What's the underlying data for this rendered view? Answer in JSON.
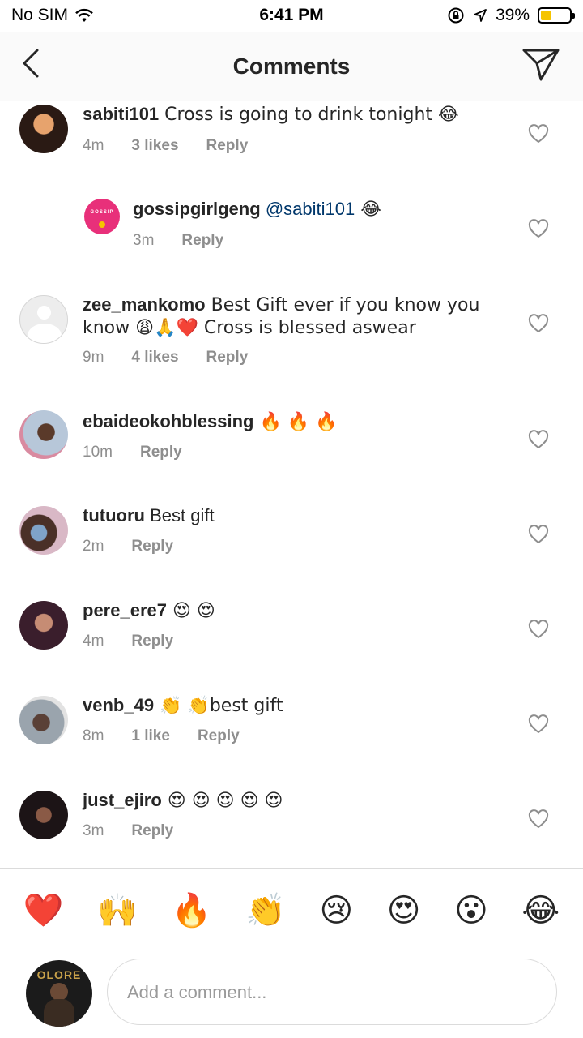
{
  "status": {
    "carrier": "No SIM",
    "time": "6:41 PM",
    "battery": "39%",
    "battery_level": 0.39
  },
  "nav": {
    "title": "Comments"
  },
  "comments": [
    {
      "username": "sabiti101",
      "text": " Cross is going to drink tonight 😂",
      "time": "4m",
      "likes": "3 likes",
      "reply": "Reply"
    },
    {
      "username": "gossipgirlgeng",
      "mention": "@sabiti101",
      "text": " 😂",
      "time": "3m",
      "reply": "Reply"
    },
    {
      "username": "zee_mankomo",
      "text": " Best Gift ever if you know you know 😩🙏❤️ Cross is blessed aswear",
      "time": "9m",
      "likes": "4 likes",
      "reply": "Reply"
    },
    {
      "username": "ebaideokohblessing",
      "text": " 🔥 🔥 🔥",
      "time": "10m",
      "reply": "Reply"
    },
    {
      "username": "tutuoru",
      "text": " Best gift",
      "time": "2m",
      "reply": "Reply"
    },
    {
      "username": "pere_ere7",
      "text": " 😍 😍",
      "time": "4m",
      "reply": "Reply"
    },
    {
      "username": "venb_49",
      "text": " 👏 👏best gift",
      "time": "8m",
      "likes": "1 like",
      "reply": "Reply"
    },
    {
      "username": "just_ejiro",
      "text": " 😍 😍 😍 😍 😍",
      "time": "3m",
      "reply": "Reply"
    }
  ],
  "reactions": [
    "❤️",
    "🙌",
    "🔥",
    "👏",
    "😢",
    "😍",
    "😮",
    "😂"
  ],
  "composer": {
    "placeholder": "Add a comment...",
    "avatar_text": "OLORE"
  },
  "colors": {
    "text": "#262626",
    "meta": "#8e8e8e",
    "mention": "#00376b",
    "divider": "#dbdbdb"
  }
}
